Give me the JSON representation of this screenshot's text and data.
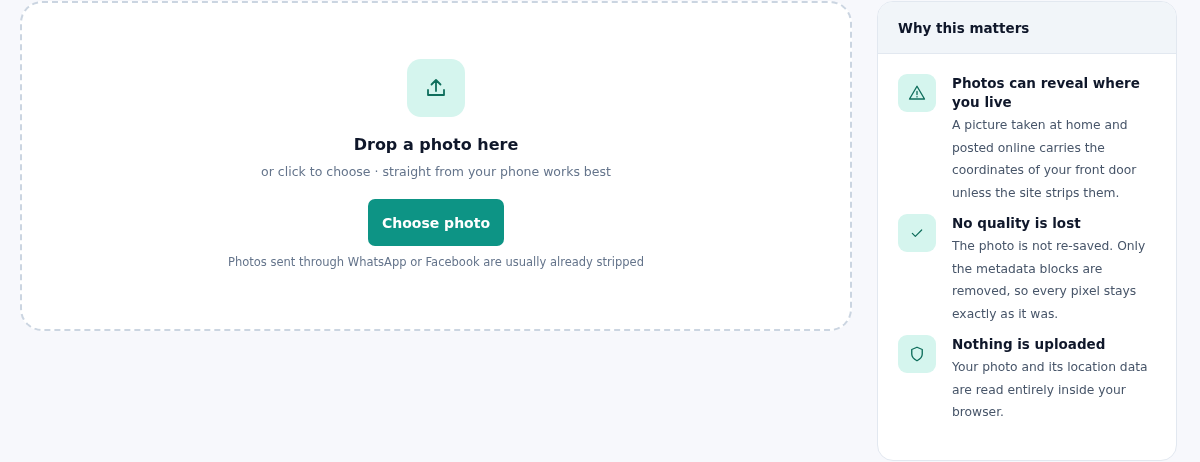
{
  "dropzone": {
    "title": "Drop a photo here",
    "subtitle": "or click to choose · straight from your phone works best",
    "button": "Choose photo",
    "note": "Photos sent through WhatsApp or Facebook are usually already stripped"
  },
  "panel": {
    "title": "Why this matters",
    "items": [
      {
        "kind": "warning",
        "title": "Photos can reveal where you live",
        "text": "A picture taken at home and posted online carries the coordinates of your front door unless the site strips them."
      },
      {
        "kind": "check",
        "title": "No quality is lost",
        "text": "The photo is not re-saved. Only the metadata blocks are removed, so every pixel stays exactly as it was."
      },
      {
        "kind": "shield",
        "title": "Nothing is uploaded",
        "text": "Your photo and its location data are read entirely inside your browser."
      }
    ]
  }
}
